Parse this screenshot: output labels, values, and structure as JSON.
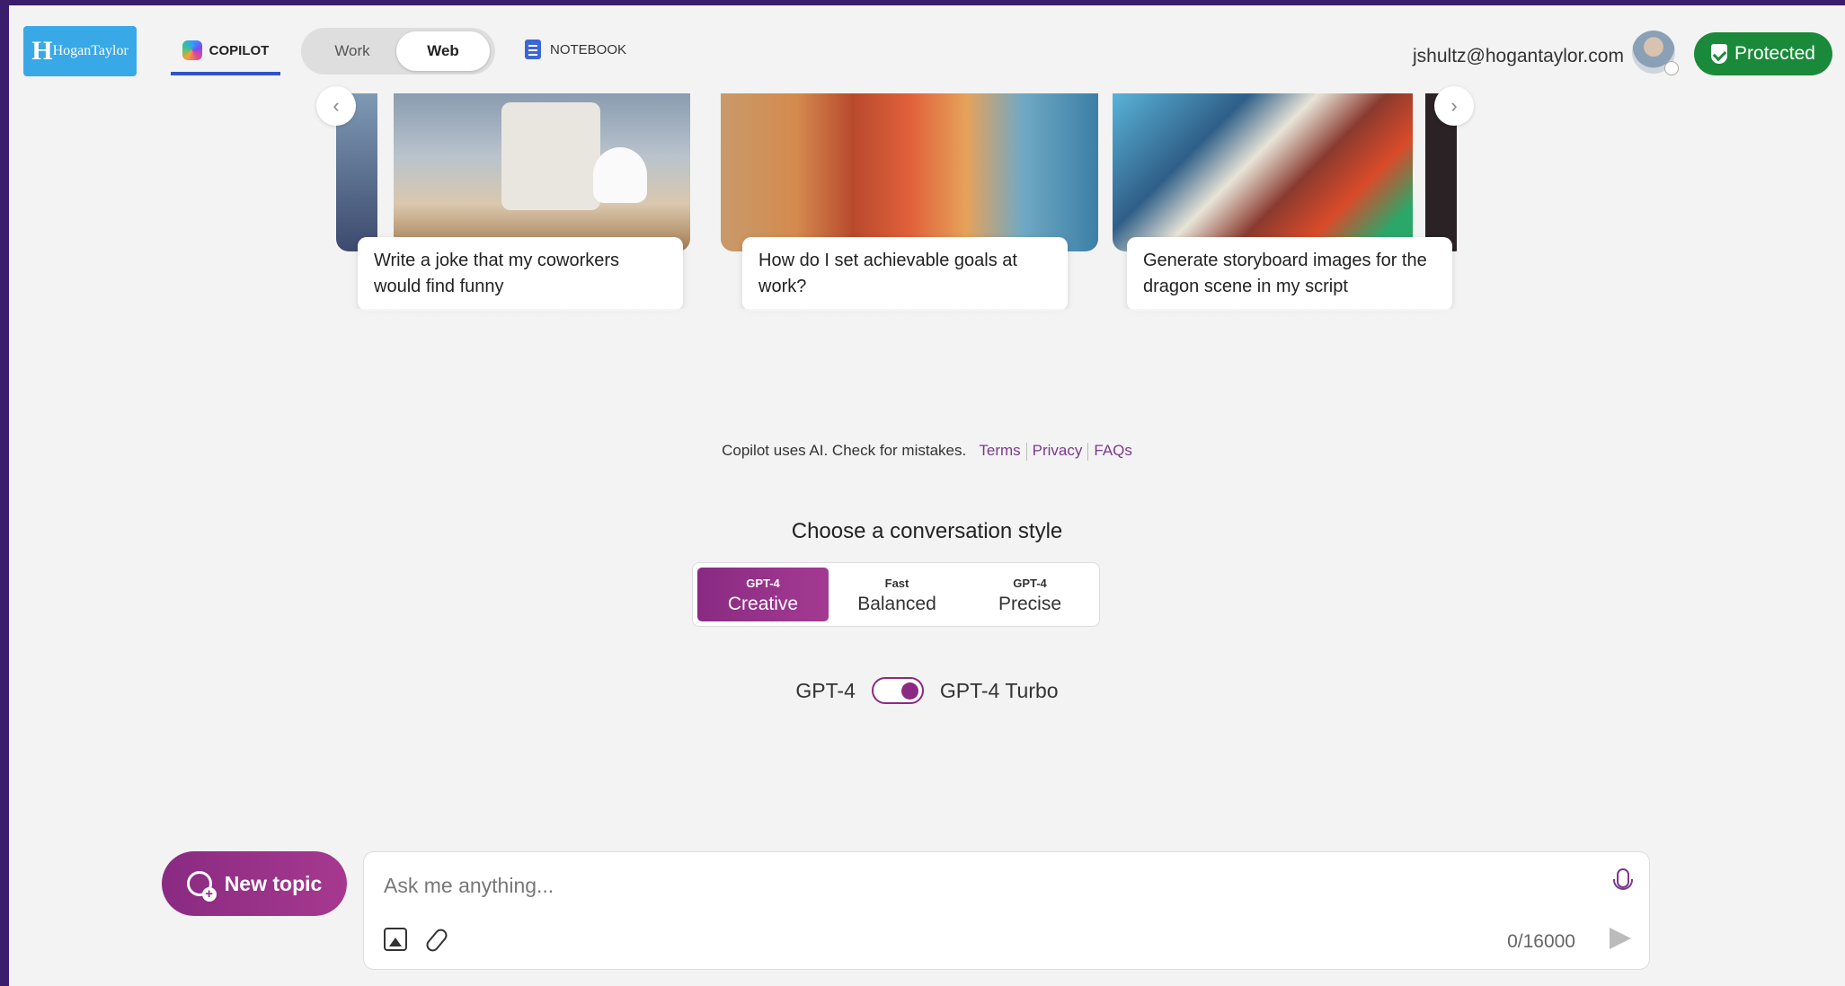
{
  "header": {
    "logo_text": "HoganTaylor",
    "logo_mark": "H",
    "tab_copilot": "COPILOT",
    "mode_work": "Work",
    "mode_web": "Web",
    "tab_notebook": "NOTEBOOK",
    "user_email": "jshultz@hogantaylor.com",
    "protected_label": "Protected"
  },
  "carousel": {
    "prev_icon": "chevron-left-icon",
    "next_icon": "chevron-right-icon",
    "prev_glyph": "‹",
    "next_glyph": "›",
    "cards": [
      {
        "text": "Write a joke that my coworkers would find funny"
      },
      {
        "text": "How do I set achievable goals at work?"
      },
      {
        "text": "Generate storyboard images for the dragon scene in my script"
      }
    ]
  },
  "disclaimer": {
    "text": "Copilot uses AI. Check for mistakes.",
    "terms": "Terms",
    "privacy": "Privacy",
    "faqs": "FAQs"
  },
  "conversation_style": {
    "title": "Choose a conversation style",
    "options": [
      {
        "sub": "GPT-4",
        "label": "Creative",
        "selected": true
      },
      {
        "sub": "Fast",
        "label": "Balanced",
        "selected": false
      },
      {
        "sub": "GPT-4",
        "label": "Precise",
        "selected": false
      }
    ]
  },
  "model_toggle": {
    "left_label": "GPT-4",
    "right_label": "GPT-4 Turbo",
    "on": true
  },
  "composer": {
    "new_topic": "New topic",
    "placeholder": "Ask me anything...",
    "counter": "0/16000"
  },
  "colors": {
    "accent": "#8a2a82",
    "protected": "#1a8a3a",
    "tab_underline": "#2f53c9",
    "logo_bg": "#38a9e6"
  }
}
